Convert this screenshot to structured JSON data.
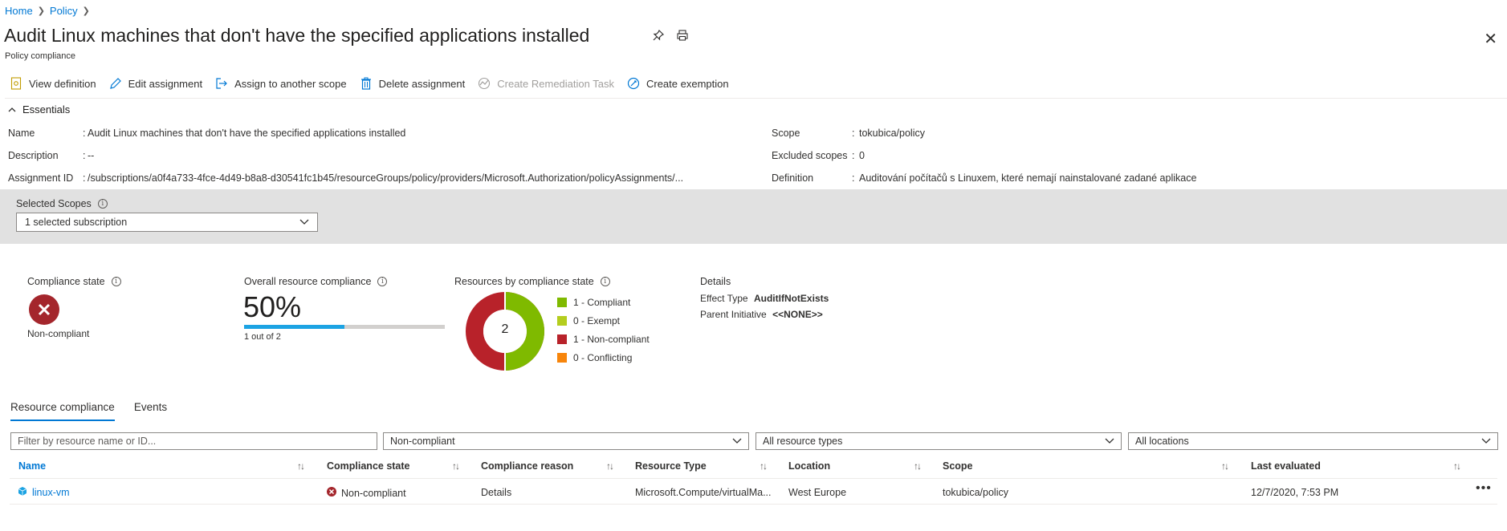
{
  "breadcrumb": {
    "home": "Home",
    "policy": "Policy"
  },
  "title": "Audit Linux machines that don't have the specified applications installed",
  "subtitle": "Policy compliance",
  "toolbar": {
    "view_definition": "View definition",
    "edit_assignment": "Edit assignment",
    "assign_scope": "Assign to another scope",
    "delete_assignment": "Delete assignment",
    "create_remediation": "Create Remediation Task",
    "create_exemption": "Create exemption"
  },
  "essentials": {
    "header": "Essentials",
    "name_label": "Name",
    "name_value": "Audit Linux machines that don't have the specified applications installed",
    "description_label": "Description",
    "description_value": "--",
    "assignment_id_label": "Assignment ID",
    "assignment_id_value": "/subscriptions/a0f4a733-4fce-4d49-b8a8-d30541fc1b45/resourceGroups/policy/providers/Microsoft.Authorization/policyAssignments/...",
    "scope_label": "Scope",
    "scope_value": "tokubica/policy",
    "excluded_label": "Excluded scopes",
    "excluded_value": "0",
    "definition_label": "Definition",
    "definition_value": "Auditování počítačů s Linuxem, které nemají nainstalované zadané aplikace"
  },
  "scopes": {
    "label": "Selected Scopes",
    "value": "1 selected subscription"
  },
  "compliance_state": {
    "label": "Compliance state",
    "value": "Non-compliant"
  },
  "overall": {
    "label": "Overall resource compliance",
    "percent": "50%",
    "fraction": 0.5,
    "detail": "1 out of 2"
  },
  "by_state": {
    "label": "Resources by compliance state",
    "total": "2",
    "legend": [
      {
        "label": "1 - Compliant",
        "color": "#7fba00",
        "value": 1
      },
      {
        "label": "0 - Exempt",
        "color": "#b4cd1e",
        "value": 0
      },
      {
        "label": "1 - Non-compliant",
        "color": "#b8222a",
        "value": 1
      },
      {
        "label": "0 - Conflicting",
        "color": "#f7850b",
        "value": 0
      }
    ]
  },
  "details": {
    "label": "Details",
    "effect_label": "Effect Type",
    "effect_value": "AuditIfNotExists",
    "initiative_label": "Parent Initiative",
    "initiative_value": "<<NONE>>"
  },
  "tabs": [
    "Resource compliance",
    "Events"
  ],
  "filters": {
    "search_placeholder": "Filter by resource name or ID...",
    "state": "Non-compliant",
    "types": "All resource types",
    "locations": "All locations"
  },
  "table": {
    "headers": [
      "Name",
      "Compliance state",
      "Compliance reason",
      "Resource Type",
      "Location",
      "Scope",
      "Last evaluated"
    ],
    "rows": [
      {
        "name": "linux-vm",
        "state": "Non-compliant",
        "reason": "Details",
        "type": "Microsoft.Compute/virtualMa...",
        "location": "West Europe",
        "scope": "tokubica/policy",
        "evaluated": "12/7/2020, 7:53 PM"
      }
    ]
  },
  "colors": {
    "accent": "#0078d4",
    "noncompliant": "#a4262c",
    "compliant": "#7fba00",
    "progress": "#1ca3e3"
  }
}
